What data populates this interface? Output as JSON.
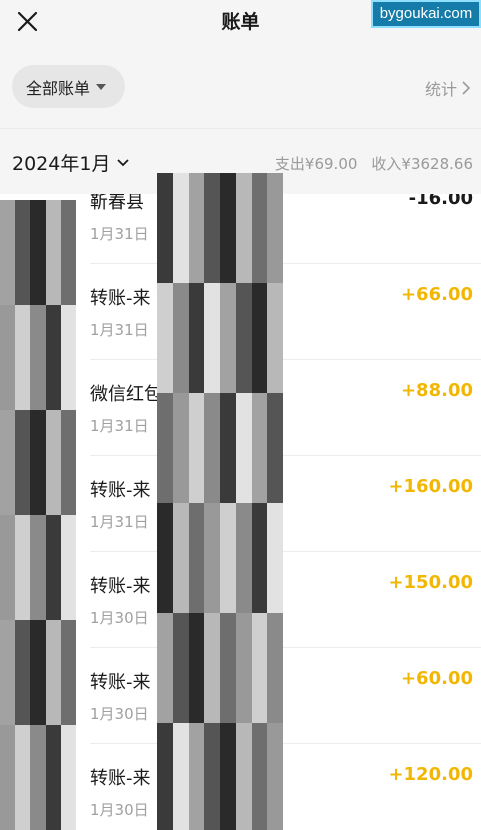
{
  "header": {
    "title": "账单",
    "watermark": "bygoukai.com"
  },
  "filter": {
    "label": "全部账单",
    "stats_label": "统计"
  },
  "month": {
    "label": "2024年1月",
    "expense": "支出¥69.00",
    "income": "收入¥3628.66"
  },
  "transactions": [
    {
      "title": "靳春县",
      "date": "1月31日",
      "amount": "-16.00",
      "type": "expense"
    },
    {
      "title": "转账-来                 镁，60元",
      "date": "1月31日",
      "amount": "+66.00",
      "type": "income"
    },
    {
      "title": "微信红包                 克隆，6…",
      "date": "1月31日",
      "amount": "+88.00",
      "type": "income"
    },
    {
      "title": "转账-来                 文字转…",
      "date": "1月31日",
      "amount": "+160.00",
      "type": "income"
    },
    {
      "title": "转账-来                 模型",
      "date": "1月30日",
      "amount": "+150.00",
      "type": "income"
    },
    {
      "title": "转账-来                 克隆",
      "date": "1月30日",
      "amount": "+60.00",
      "type": "income"
    },
    {
      "title": "转账-来                 so-vits",
      "date": "1月30日",
      "amount": "+120.00",
      "type": "income"
    }
  ]
}
